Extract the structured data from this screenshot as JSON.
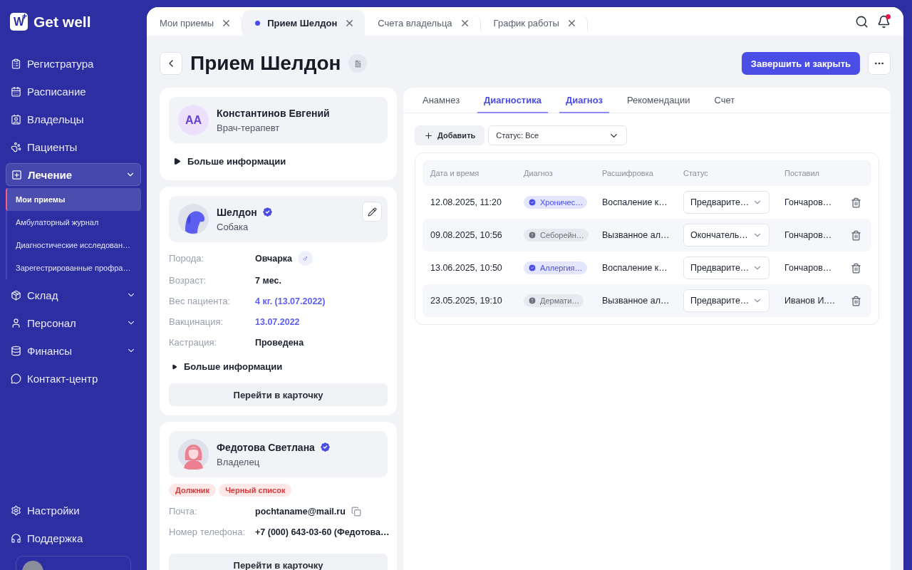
{
  "brand": {
    "logo": "W",
    "name": "Get well"
  },
  "sidebar": {
    "items": [
      {
        "label": "Регистратура",
        "selected": false
      },
      {
        "label": "Расписание",
        "selected": false
      },
      {
        "label": "Владельцы",
        "selected": false
      },
      {
        "label": "Пациенты",
        "selected": false
      },
      {
        "label": "Лечение",
        "selected": true,
        "expanded": true,
        "children": [
          {
            "label": "Мои приемы",
            "selected": true
          },
          {
            "label": "Амбулаторный журнал",
            "selected": false
          },
          {
            "label": "Диагностические исследован…",
            "selected": false
          },
          {
            "label": "Зарегестрированные профра…",
            "selected": false
          }
        ]
      },
      {
        "label": "Склад",
        "selected": false,
        "expanded": false
      },
      {
        "label": "Персонал",
        "selected": false,
        "expanded": false
      },
      {
        "label": "Финансы",
        "selected": false,
        "expanded": false
      },
      {
        "label": "Контакт-центр",
        "selected": false
      }
    ],
    "footer_items": [
      {
        "label": "Настройки"
      },
      {
        "label": "Поддержка"
      }
    ]
  },
  "tabs": [
    {
      "label": "Мои приемы",
      "selected": false,
      "unsaved": false
    },
    {
      "label": "Прием Шелдон",
      "selected": true,
      "unsaved": true
    },
    {
      "label": "Счета владельца",
      "selected": false,
      "unsaved": false
    },
    {
      "label": "График работы",
      "selected": false,
      "unsaved": false
    }
  ],
  "notifications": {
    "unread": true
  },
  "page": {
    "title": "Прием Шелдон",
    "primary_button": "Завершить и закрыть"
  },
  "doctor": {
    "initials": "АА",
    "name": "Константинов Евгений",
    "role": "Врач-терапевт",
    "more": "Больше информации"
  },
  "patient": {
    "name": "Шелдон",
    "verified": true,
    "species": "Собака",
    "fields": [
      {
        "label": "Порода:",
        "value": "Овчарка",
        "sex": "♂",
        "kind": "text"
      },
      {
        "label": "Возраст:",
        "value": "7 мес.",
        "kind": "text"
      },
      {
        "label": "Вес пациента:",
        "value": "4 кг. (13.07.2022)",
        "kind": "link"
      },
      {
        "label": "Вакцинация:",
        "value": "13.07.2022",
        "kind": "link"
      },
      {
        "label": "Кастрация:",
        "value": "Проведена",
        "kind": "text"
      }
    ],
    "more": "Больше информации",
    "button": "Перейти в карточку"
  },
  "owner": {
    "name": "Федотова Светлана",
    "verified": true,
    "role": "Владелец",
    "tags": [
      {
        "label": "Должник"
      },
      {
        "label": "Черный список"
      }
    ],
    "fields": [
      {
        "label": "Почта:",
        "value": "pochtaname@mail.ru",
        "copyable": true
      },
      {
        "label": "Номер телефона:",
        "value": "+7 (000) 643-03-60 (Федотова…",
        "copyable": false
      }
    ],
    "button": "Перейти в карточку"
  },
  "section_tabs": [
    {
      "label": "Анамнез",
      "selected": false
    },
    {
      "label": "Диагностика",
      "selected": true
    },
    {
      "label": "Диагноз",
      "selected": true
    },
    {
      "label": "Рекомендации",
      "selected": false
    },
    {
      "label": "Счет",
      "selected": false
    }
  ],
  "toolbar": {
    "add_button": "Добавить",
    "status_filter": "Статус: Все"
  },
  "table": {
    "columns": [
      "Дата и время",
      "Диагноз",
      "Расшифровка",
      "Статус",
      "Поставил"
    ],
    "rows": [
      {
        "datetime": "12.08.2025, 11:20",
        "diagnosis": {
          "label": "Хроничес…",
          "kind": "confirmed"
        },
        "decoding": "Воспаление к…",
        "status": "Предварите…",
        "author": "Гончаров…"
      },
      {
        "datetime": "09.08.2025, 10:56",
        "diagnosis": {
          "label": "Себорейн…",
          "kind": "pending"
        },
        "decoding": "Вызванное ал…",
        "status": "Окончатель…",
        "author": "Гончаров…"
      },
      {
        "datetime": "13.06.2025, 10:50",
        "diagnosis": {
          "label": "Аллергия…",
          "kind": "confirmed"
        },
        "decoding": "Воспаление к…",
        "status": "Предварите…",
        "author": "Гончаров…"
      },
      {
        "datetime": "23.05.2025, 19:10",
        "diagnosis": {
          "label": "Дермати…",
          "kind": "pending"
        },
        "decoding": "Вызванное ал…",
        "status": "Предварите…",
        "author": "Иванов И.…"
      }
    ]
  }
}
